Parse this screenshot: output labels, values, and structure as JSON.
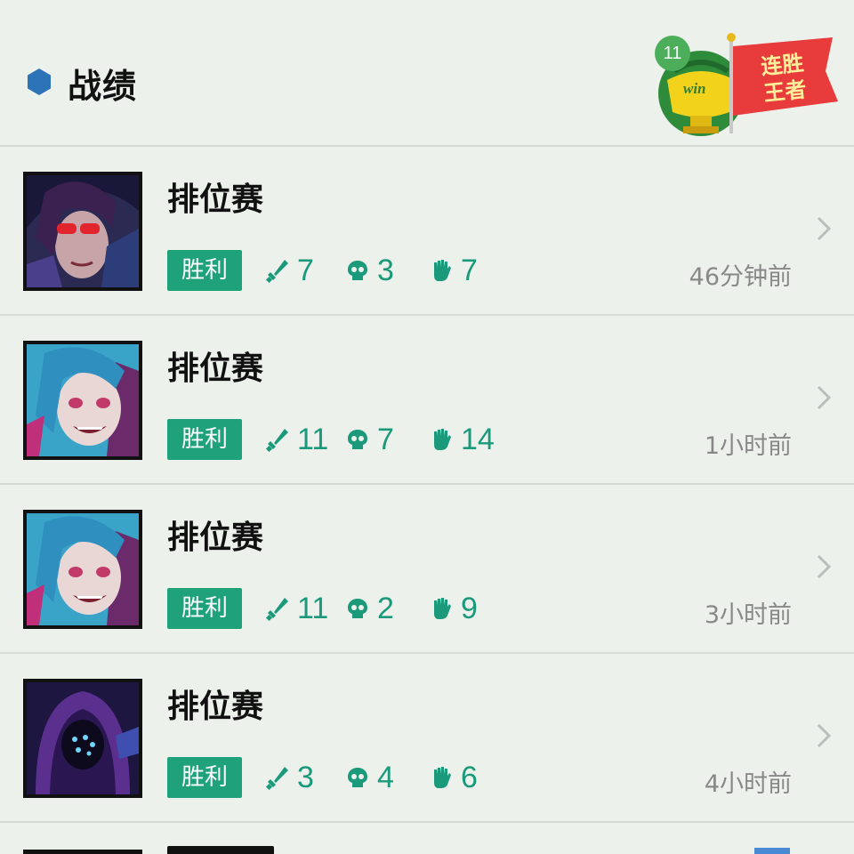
{
  "header": {
    "title": "战绩",
    "badge": {
      "streak_count": "11",
      "win_label": "win",
      "flag_text": "连胜王者"
    }
  },
  "matches": [
    {
      "mode": "排位赛",
      "result": "胜利",
      "kills": "7",
      "deaths": "3",
      "assists": "7",
      "time": "46分钟前",
      "champion_icon": "vayne-portrait"
    },
    {
      "mode": "排位赛",
      "result": "胜利",
      "kills": "11",
      "deaths": "7",
      "assists": "14",
      "time": "1小时前",
      "champion_icon": "jinx-portrait"
    },
    {
      "mode": "排位赛",
      "result": "胜利",
      "kills": "11",
      "deaths": "2",
      "assists": "9",
      "time": "3小时前",
      "champion_icon": "jinx-portrait"
    },
    {
      "mode": "排位赛",
      "result": "胜利",
      "kills": "3",
      "deaths": "4",
      "assists": "6",
      "time": "4小时前",
      "champion_icon": "kassadin-portrait"
    }
  ],
  "colors": {
    "accent": "#1fa27a",
    "stat_text": "#1a9a7a",
    "background": "#edf1ec",
    "hex_bullet": "#2c73b8"
  }
}
